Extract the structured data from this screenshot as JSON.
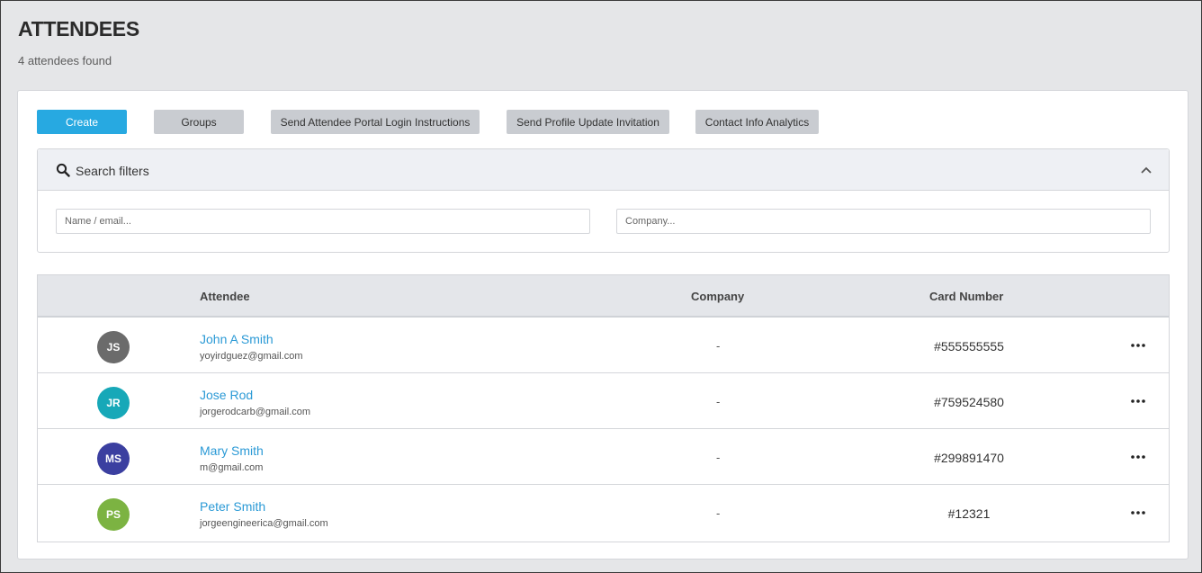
{
  "header": {
    "title": "ATTENDEES",
    "subtitle": "4 attendees found"
  },
  "toolbar": {
    "create_label": "Create",
    "groups_label": "Groups",
    "portal_login_label": "Send Attendee Portal Login Instructions",
    "profile_update_label": "Send Profile Update Invitation",
    "analytics_label": "Contact Info Analytics"
  },
  "filters": {
    "title": "Search filters",
    "name_placeholder": "Name / email...",
    "name_value": "",
    "company_placeholder": "Company...",
    "company_value": ""
  },
  "table": {
    "columns": [
      "Attendee",
      "Company",
      "Card Number"
    ],
    "rows": [
      {
        "initials": "JS",
        "avatar_color": "#6b6b6b",
        "name": "John A Smith",
        "email": "yoyirdguez@gmail.com",
        "company": "-",
        "card": "#555555555"
      },
      {
        "initials": "JR",
        "avatar_color": "#17a8b8",
        "name": "Jose Rod",
        "email": "jorgerodcarb@gmail.com",
        "company": "-",
        "card": "#759524580"
      },
      {
        "initials": "MS",
        "avatar_color": "#3b3fa0",
        "name": "Mary Smith",
        "email": "m@gmail.com",
        "company": "-",
        "card": "#299891470"
      },
      {
        "initials": "PS",
        "avatar_color": "#7cb342",
        "name": "Peter Smith",
        "email": "jorgeengineerica@gmail.com",
        "company": "-",
        "card": "#12321"
      }
    ]
  },
  "colors": {
    "accent": "#27a9e1",
    "link": "#2b9ad6",
    "secondary_button": "#c9ccd1"
  },
  "icons": {
    "search": "search-icon",
    "collapse": "chevron-up-icon",
    "row_actions": "more-horizontal-icon"
  }
}
